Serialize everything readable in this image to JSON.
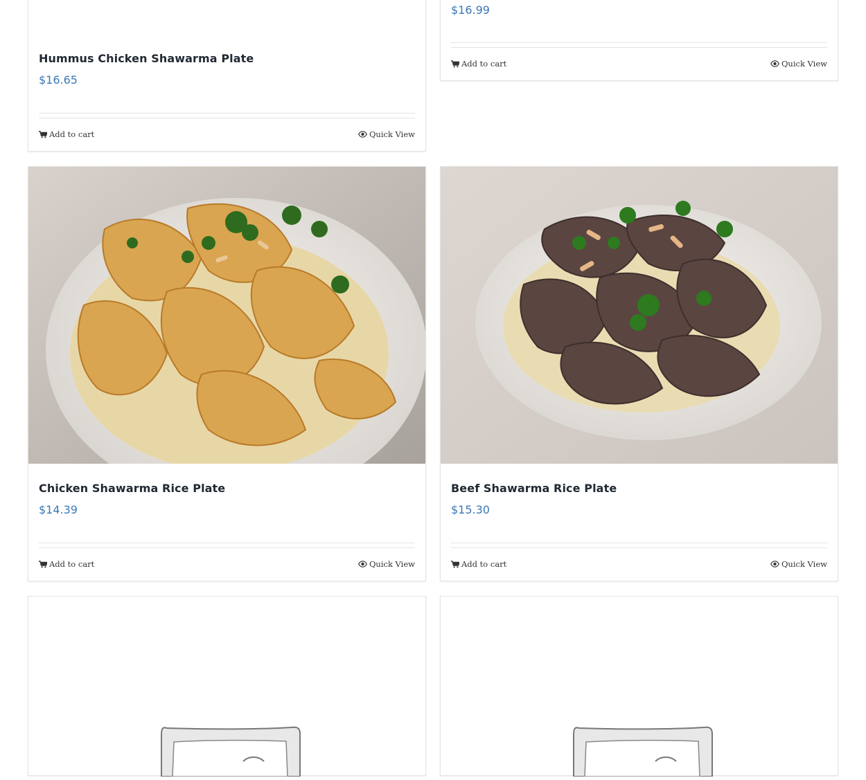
{
  "colors": {
    "price": "#3b78b5",
    "title": "#212934",
    "border": "#e4e4e4"
  },
  "products": [
    {
      "title": "Hummus Chicken Shawarma Plate",
      "price": "$16.65",
      "add_to_cart": "Add to cart",
      "quick_view": "Quick View"
    },
    {
      "title": "",
      "price": "$16.99",
      "add_to_cart": "Add to cart",
      "quick_view": "Quick View"
    },
    {
      "title": "Chicken Shawarma Rice Plate",
      "price": "$14.39",
      "add_to_cart": "Add to cart",
      "quick_view": "Quick View",
      "image": "chicken-shawarma-rice-photo"
    },
    {
      "title": "Beef Shawarma Rice Plate",
      "price": "$15.30",
      "add_to_cart": "Add to cart",
      "quick_view": "Quick View",
      "image": "beef-shawarma-rice-photo"
    },
    {
      "image": "placeholder-image"
    },
    {
      "image": "placeholder-image"
    }
  ],
  "icons": {
    "cart": "cart-icon",
    "quick_view": "eye-icon"
  }
}
